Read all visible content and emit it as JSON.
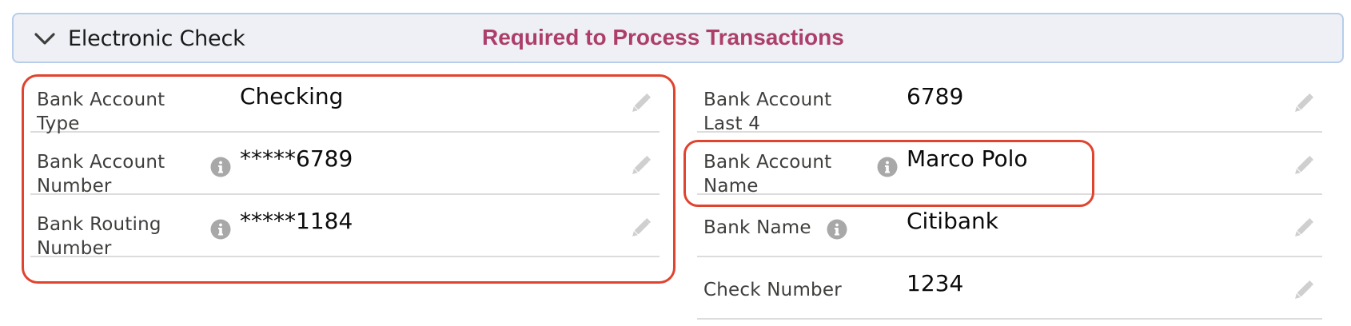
{
  "section": {
    "title": "Electronic Check",
    "required_note": "Required to Process Transactions",
    "icon": "chevron-down-icon"
  },
  "left_fields": [
    {
      "label_line1": "Bank Account",
      "label_line2": "Type",
      "value": "Checking",
      "has_info": false
    },
    {
      "label_line1": "Bank Account",
      "label_line2": "Number",
      "value": "*****6789",
      "has_info": true
    },
    {
      "label_line1": "Bank Routing",
      "label_line2": "Number",
      "value": "*****1184",
      "has_info": true
    }
  ],
  "right_fields": [
    {
      "label_line1": "Bank Account",
      "label_line2": "Last 4",
      "value": "6789",
      "has_info": false
    },
    {
      "label_line1": "Bank Account",
      "label_line2": "Name",
      "value": "Marco Polo",
      "has_info": true
    },
    {
      "label_line1": "Bank Name",
      "label_line2": "",
      "value": "Citibank",
      "has_info": true
    },
    {
      "label_line1": "Check Number",
      "label_line2": "",
      "value": "1234",
      "has_info": false
    }
  ],
  "colors": {
    "header_bg": "#eef0f5",
    "header_border": "#b8cdea",
    "required_note": "#ad3e6b",
    "highlight": "#e0432e",
    "icon_gray": "#a8a8a8",
    "edit_icon": "#cfcfcf"
  },
  "icons": {
    "info": "info-icon",
    "edit": "pencil-edit-icon"
  }
}
